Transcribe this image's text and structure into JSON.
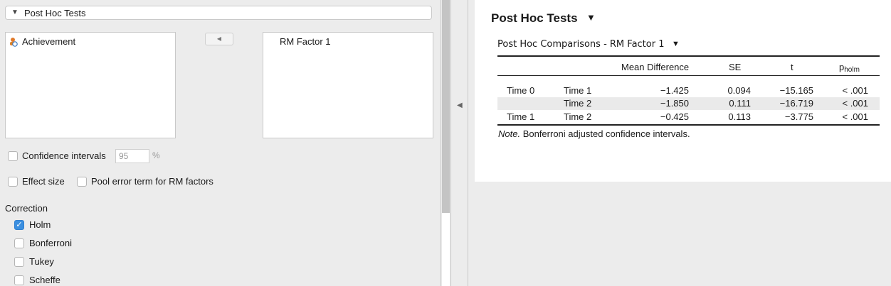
{
  "section": {
    "title": "Post Hoc Tests",
    "toggle_icon": "triangle-down-icon"
  },
  "variables": {
    "available": [
      {
        "label": "Achievement",
        "icon": "scale-variable-icon"
      }
    ],
    "move_icon": "arrow-left-icon",
    "selected": [
      {
        "label": "RM Factor 1"
      }
    ]
  },
  "options": {
    "confidence_intervals": {
      "label": "Confidence intervals",
      "checked": false,
      "value": "95",
      "unit": "%"
    },
    "effect_size": {
      "label": "Effect size",
      "checked": false
    },
    "pool_error": {
      "label": "Pool error term for RM factors",
      "checked": false
    }
  },
  "correction": {
    "heading": "Correction",
    "items": [
      {
        "label": "Holm",
        "checked": true
      },
      {
        "label": "Bonferroni",
        "checked": false
      },
      {
        "label": "Tukey",
        "checked": false
      },
      {
        "label": "Scheffe",
        "checked": false
      }
    ]
  },
  "results": {
    "title": "Post Hoc Tests",
    "subtitle": "Post Hoc Comparisons - RM Factor 1",
    "table": {
      "headers": [
        "",
        "",
        "Mean Difference",
        "SE",
        "t",
        "p",
        "holm"
      ],
      "rows": [
        [
          "Time 0",
          "Time 1",
          "−1.425",
          "0.094",
          "−15.165",
          "< .001"
        ],
        [
          "",
          "Time 2",
          "−1.850",
          "0.111",
          "−16.719",
          "< .001"
        ],
        [
          "Time 1",
          "Time 2",
          "−0.425",
          "0.113",
          "−3.775",
          "< .001"
        ]
      ]
    },
    "note_label": "Note.",
    "note_text": " Bonferroni adjusted confidence intervals."
  },
  "colors": {
    "checkbox_accent": "#3b8fe0",
    "panel_bg": "#ececec",
    "results_bg": "#ffffff"
  }
}
